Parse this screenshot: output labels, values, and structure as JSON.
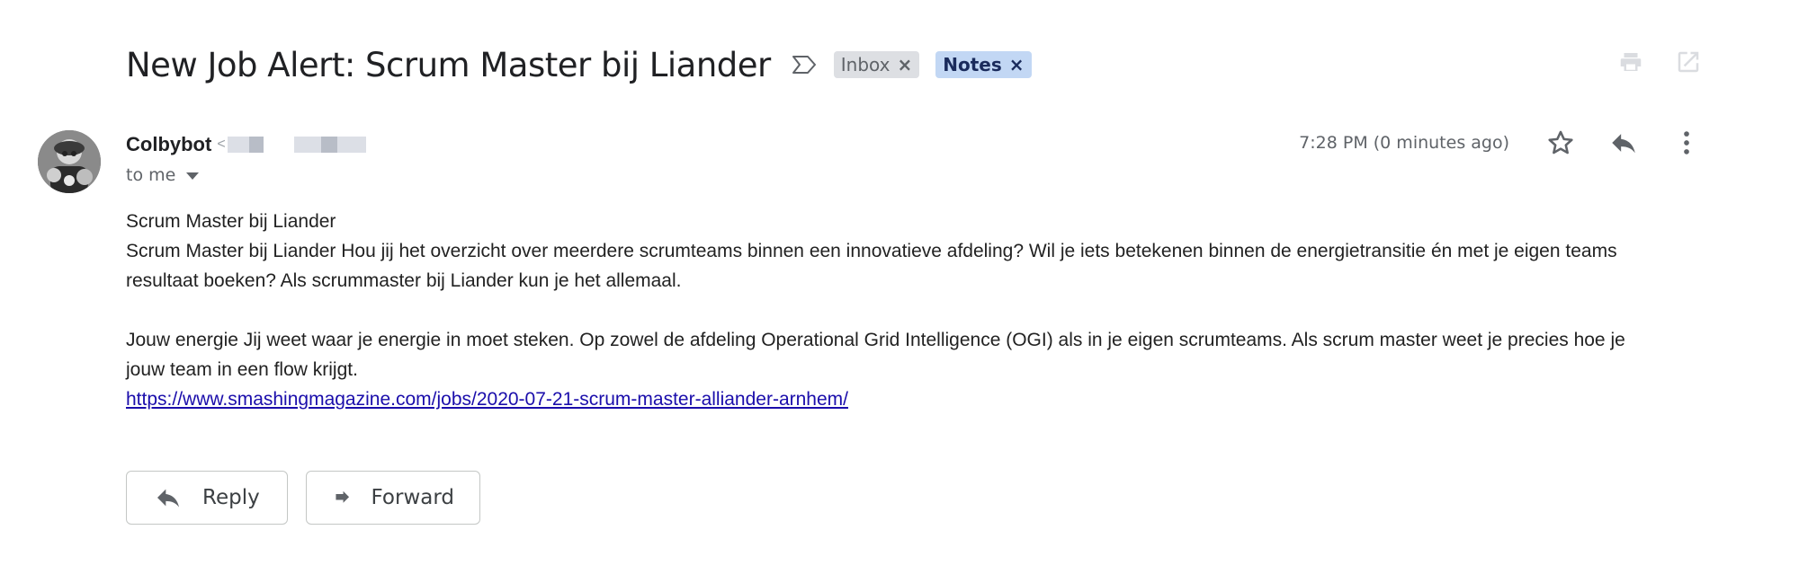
{
  "email": {
    "subject": "New Job Alert: Scrum Master bij Liander",
    "labels": [
      {
        "name": "Inbox",
        "close": "×"
      },
      {
        "name": "Notes",
        "close": "×"
      }
    ],
    "sender": {
      "name": "Colbybot",
      "email_prefix": "<"
    },
    "recipient": "to me",
    "timestamp": "7:28 PM (0 minutes ago)",
    "body": {
      "line1": "Scrum Master bij Liander",
      "para1": "Scrum Master bij Liander Hou jij het overzicht over meerdere scrumteams binnen een innovatieve afdeling? Wil je iets betekenen binnen de energietransitie én met je eigen teams resultaat boeken? Als scrummaster bij Liander kun je het allemaal.",
      "para2": "Jouw energie Jij weet waar je energie in moet steken. Op zowel de afdeling Operational Grid Intelligence (OGI) als in je eigen scrumteams. Als scrum master weet je precies hoe je jouw team in een flow krijgt.",
      "link": "https://www.smashingmagazine.com/jobs/2020-07-21-scrum-master-alliander-arnhem/"
    },
    "actions": {
      "reply": "Reply",
      "forward": "Forward"
    }
  },
  "icons": {
    "important": "label-important-outline-icon",
    "print": "print-icon",
    "open_new": "open-in-new-window-icon",
    "star": "star-icon",
    "reply": "reply-icon",
    "more": "more-vert-icon",
    "forward": "forward-icon"
  },
  "colors": {
    "inbox_chip": "#dddfe3",
    "notes_chip": "#c2d7f4",
    "link": "#1a0dab"
  }
}
